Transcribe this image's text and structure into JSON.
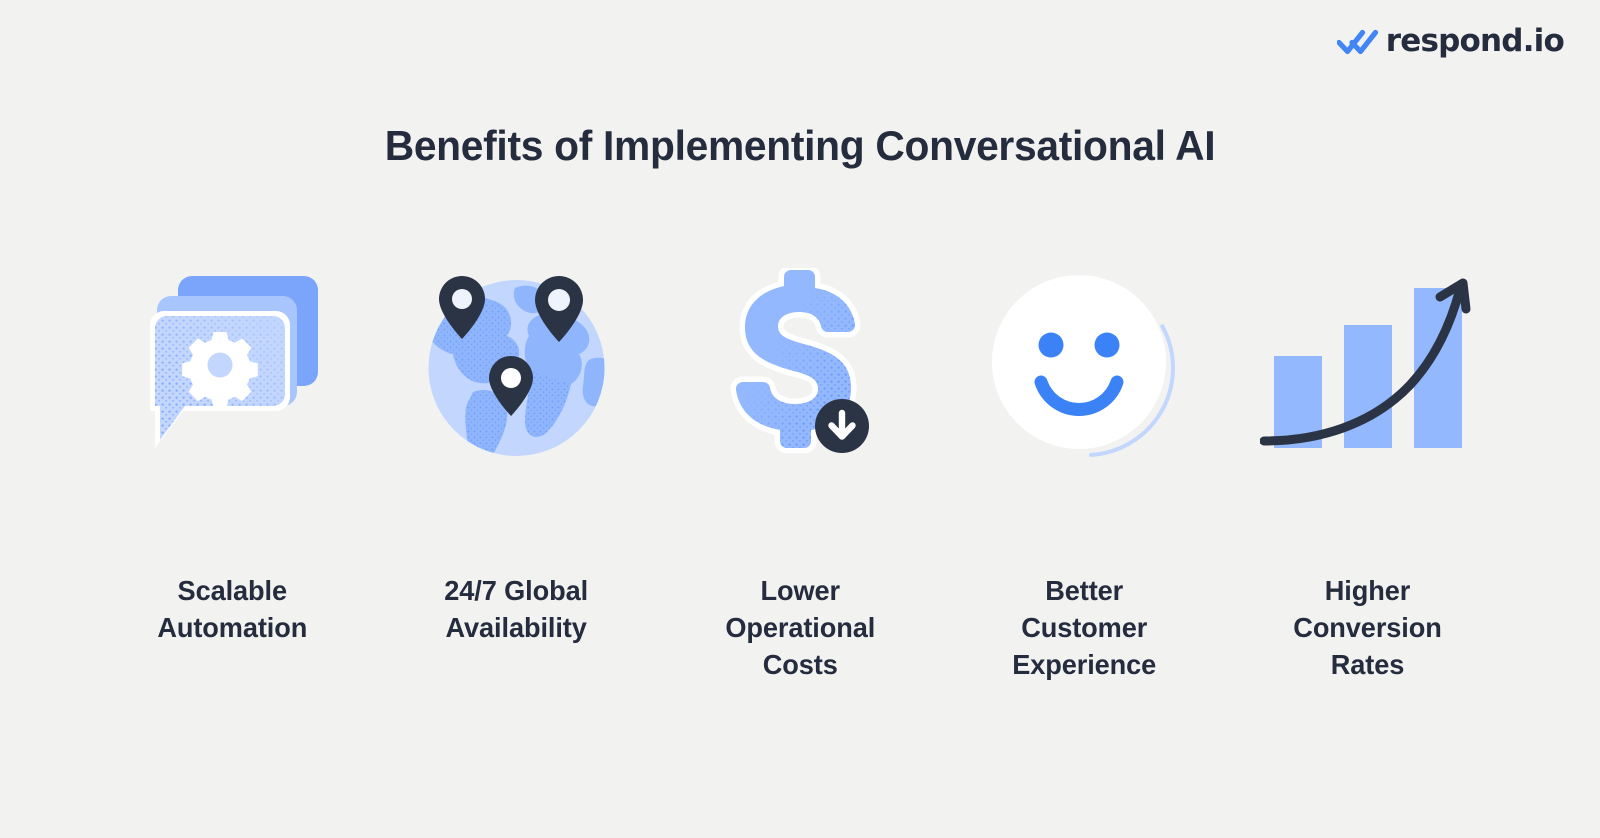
{
  "brand": {
    "logo_icon": "double-check-icon",
    "logo_text": "respond.io",
    "accent_blue": "#4285f4",
    "light_blue": "#93b8fd",
    "pale_blue": "#c3d6fd",
    "mid_blue": "#a8c5fd",
    "deep_blue": "#7ba5fb",
    "navy": "#242c3d",
    "background": "#f2f2f1"
  },
  "header": {
    "title": "Benefits of Implementing Conversational AI"
  },
  "benefits": [
    {
      "icon": "chat-bubbles-gear-icon",
      "label": "Scalable\nAutomation"
    },
    {
      "icon": "globe-map-pins-icon",
      "label": "24/7 Global\nAvailability"
    },
    {
      "icon": "dollar-down-arrow-icon",
      "label": "Lower\nOperational\nCosts"
    },
    {
      "icon": "smiley-face-icon",
      "label": "Better\nCustomer\nExperience"
    },
    {
      "icon": "growth-bar-chart-icon",
      "label": "Higher\nConversion\nRates"
    }
  ]
}
